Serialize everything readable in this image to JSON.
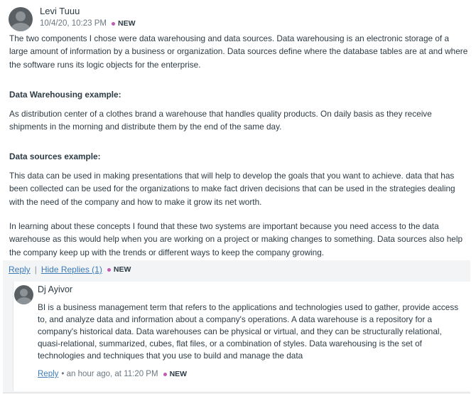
{
  "post": {
    "author": "Levi Tuuu",
    "timestamp": "10/4/20, 10:23 PM",
    "new_badge": "NEW",
    "avatar_icon": "user-avatar-icon",
    "paragraphs": {
      "intro": "The two components I chose were data warehousing and data sources. Data warehousing is an electronic storage of a large amount of information by a business or organization. Data sources define where the database tables are at and where the software runs its logic objects for the enterprise.",
      "dw_heading": "Data Warehousing example:",
      "dw_text": "As distribution center of a clothes brand  a warehouse that handles quality products. On daily basis as they receive shipments in the morning and distribute them by the end of the same day.",
      "ds_heading": "Data sources example:",
      "ds_text": "This data can be used in making presentations that will help to develop the goals that you want to achieve. data that has been collected can be  used for  the organizations to make fact driven decisions that can be used in the strategies dealing with the need of the company and how to make it grow its net worth.",
      "conclusion": "In learning about these concepts I found that these two systems are important because you need access to the data warehouse as this would help when you are working on a project or making changes to something. Data sources also help the company keep up with the trends or different ways to keep the company growing."
    },
    "actions": {
      "reply_label": "Reply",
      "separator": "|",
      "hide_replies_label": "Hide Replies (1)",
      "new_badge": "NEW"
    }
  },
  "reply": {
    "author": "Dj Ayivor",
    "text": "BI is a business management term that refers to the applications and technologies used to gather, provide access to, and analyze data and information about a company's operations. A data warehouse is a repository for a company's historical data. Data warehouses can be physical or virtual, and they can be structurally relational, quasi-relational, summarized, cubes, flat files, or a combination of styles. Data warehousing is the set of technologies and techniques that you use to build and manage the data",
    "reply_label": "Reply",
    "meta": "• an hour ago, at 11:20 PM",
    "new_badge": "NEW"
  },
  "colors": {
    "accent_new": "#c35ab4",
    "link": "#3d7bb8",
    "text": "#2d3b45"
  }
}
